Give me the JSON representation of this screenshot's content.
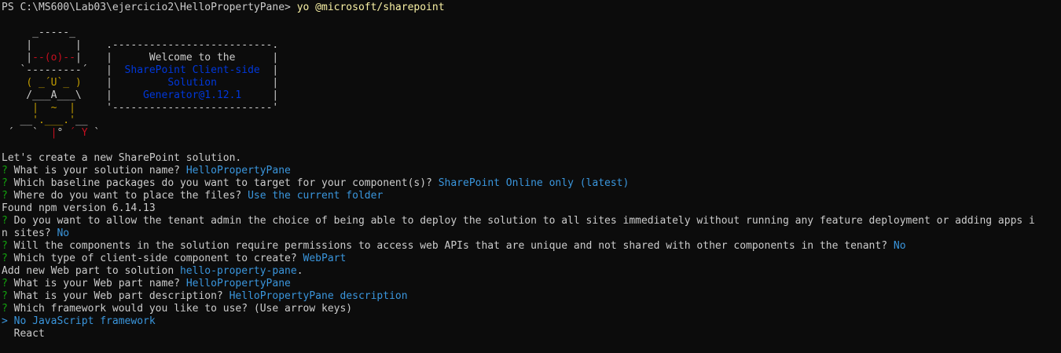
{
  "prompt": {
    "path": "PS C:\\MS600\\Lab03\\ejercicio2\\HelloPropertyPane> ",
    "command": "yo @microsoft/sharepoint"
  },
  "banner": {
    "welcome": "Welcome to the",
    "product_line1": "SharePoint Client-side",
    "product_line2": "Solution",
    "product_line3": "Generator@1.12.1"
  },
  "output": {
    "intro": "Let's create a new SharePoint solution.",
    "q1": "What is your solution name? ",
    "a1": "HelloPropertyPane",
    "q2": "Which baseline packages do you want to target for your component(s)? ",
    "a2": "SharePoint Online only (latest)",
    "q3": "Where do you want to place the files? ",
    "a3": "Use the current folder",
    "npm": "Found npm version 6.14.13",
    "q4": "Do you want to allow the tenant admin the choice of being able to deploy the solution to all sites immediately without running any feature deployment or adding apps i",
    "q4b": "n sites? ",
    "a4": "No",
    "q5": "Will the components in the solution require permissions to access web APIs that are unique and not shared with other components in the tenant? ",
    "a5": "No",
    "q6": "Which type of client-side component to create? ",
    "a6": "WebPart",
    "add": "Add new Web part to solution ",
    "add_name": "hello-property-pane",
    "add_end": ".",
    "q7": "What is your Web part name? ",
    "a7": "HelloPropertyPane",
    "q8": "What is your Web part description? ",
    "a8": "HelloPropertyPane description",
    "q9": "Which framework would you like to use? (Use arrow keys)",
    "opt_selected": "No JavaScript framework",
    "opt2": "React"
  },
  "glyphs": {
    "question_mark": "?",
    "pointer": ">"
  },
  "colors": {
    "background": "#0c0c0c",
    "text": "#cccccc",
    "question": "#13a10e",
    "answer": "#3a96dd",
    "command": "#f9f1a5",
    "banner_blue": "#0037da"
  }
}
